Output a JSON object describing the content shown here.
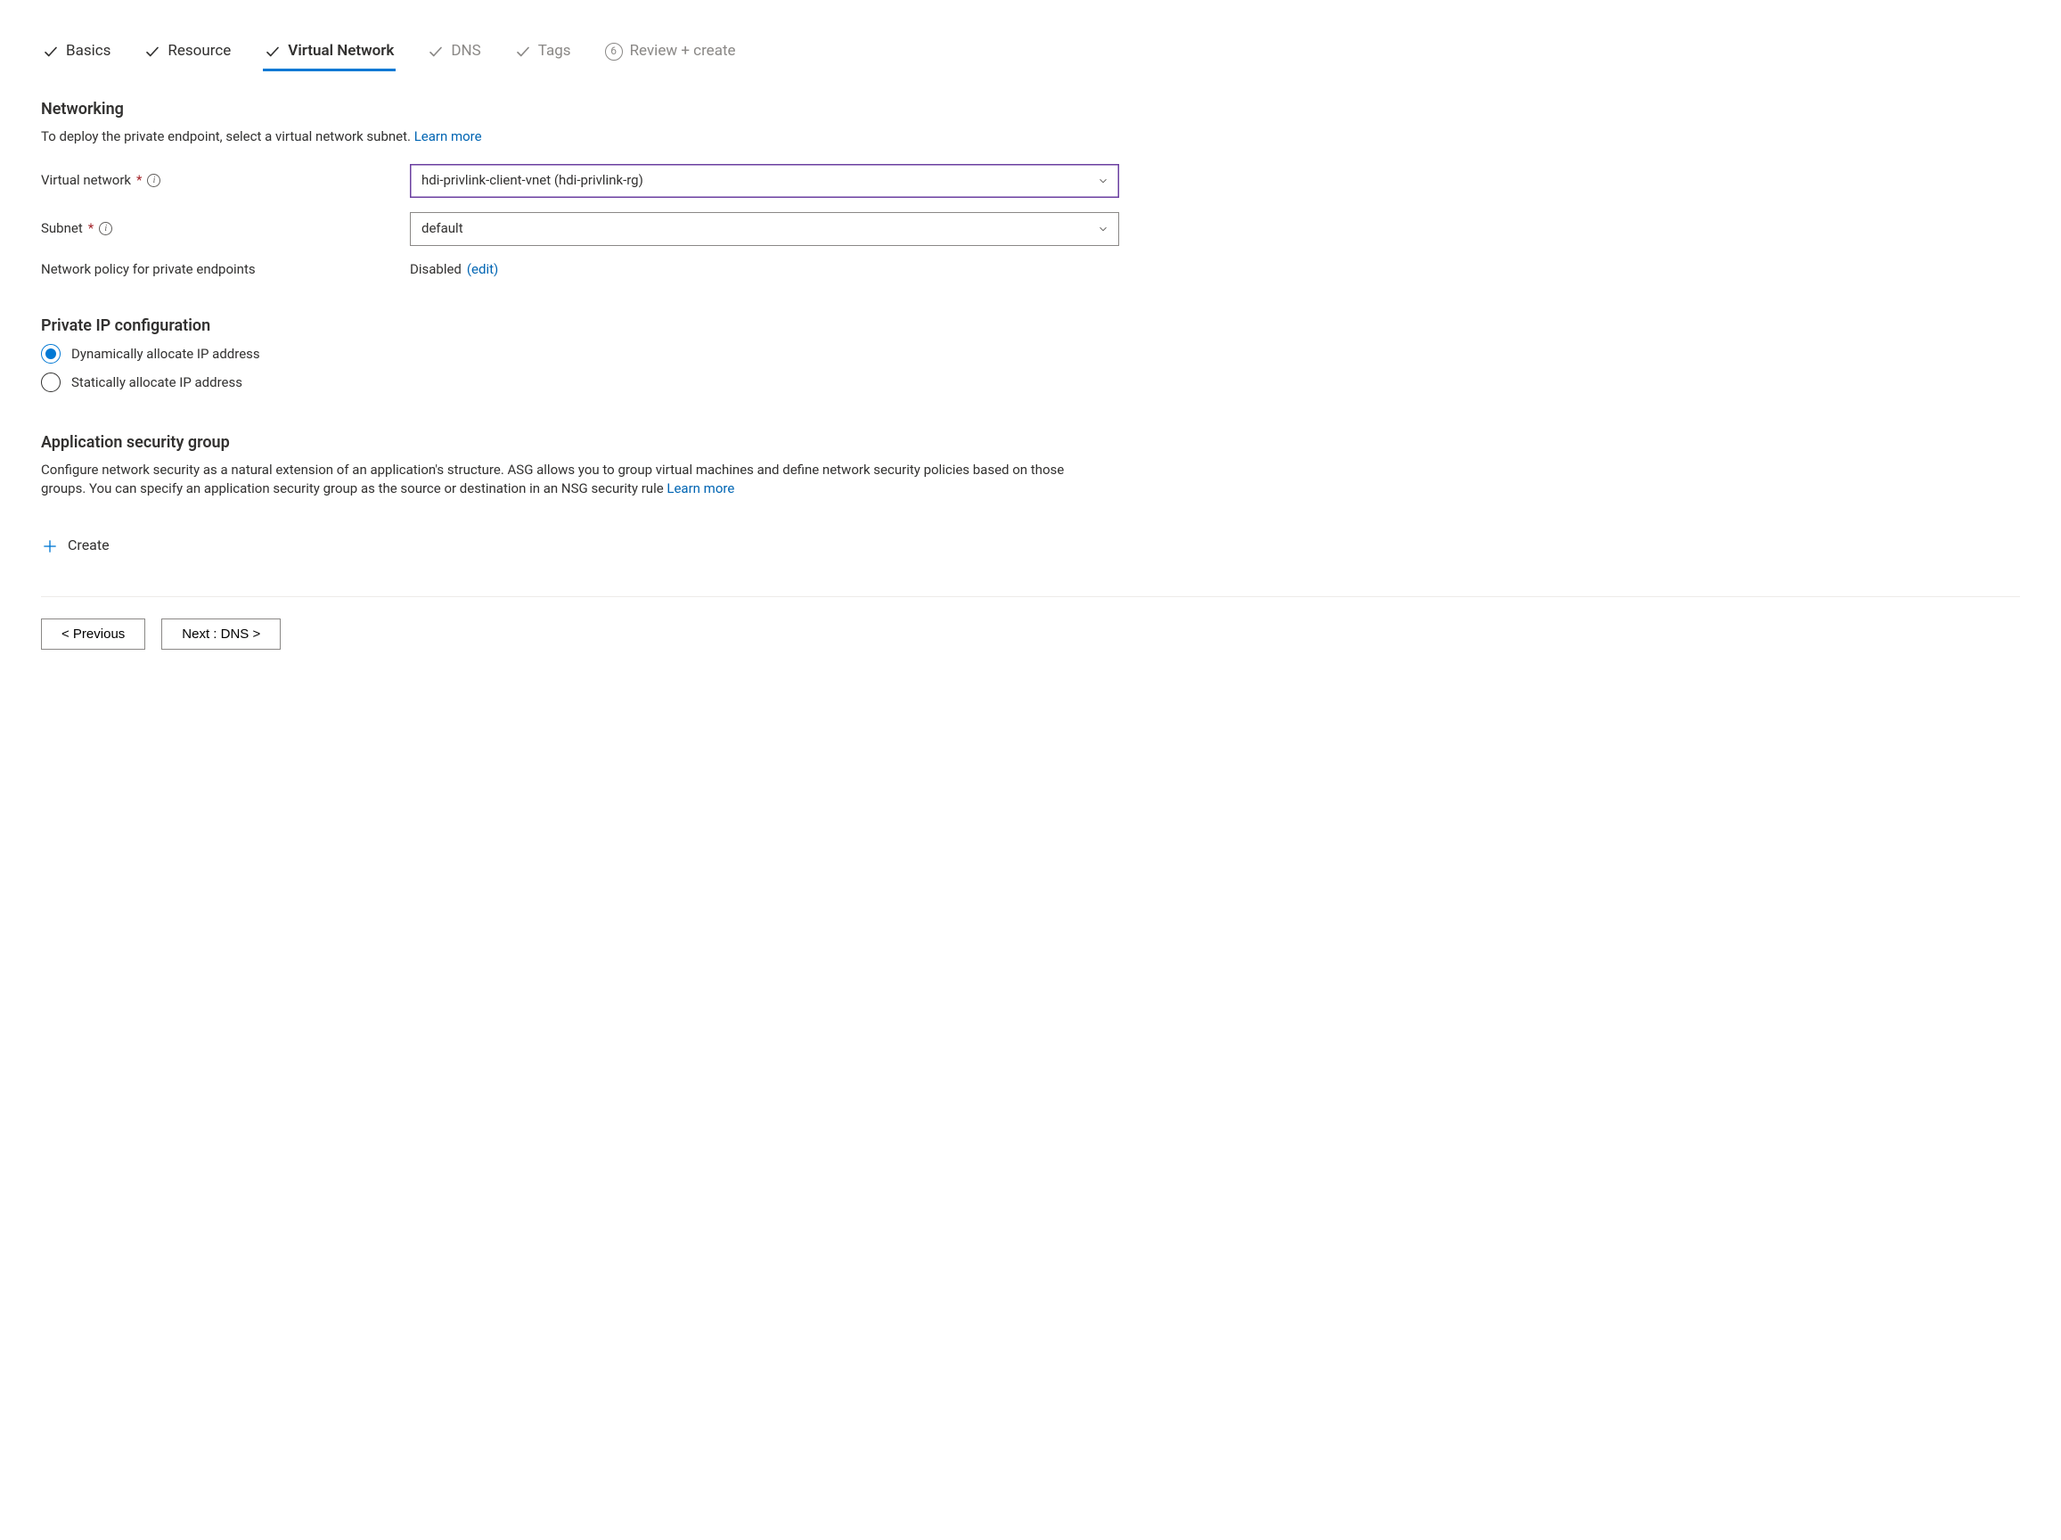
{
  "tabs": {
    "basics": "Basics",
    "resource": "Resource",
    "vnet": "Virtual Network",
    "dns": "DNS",
    "tags": "Tags",
    "review_num": "6",
    "review": "Review + create"
  },
  "networking": {
    "heading": "Networking",
    "desc": "To deploy the private endpoint, select a virtual network subnet.  ",
    "learn_more": "Learn more",
    "vnet_label": "Virtual network",
    "vnet_value": "hdi-privlink-client-vnet (hdi-privlink-rg)",
    "subnet_label": "Subnet",
    "subnet_value": "default",
    "policy_label": "Network policy for private endpoints",
    "policy_value": "Disabled",
    "policy_edit": "(edit)"
  },
  "ipconfig": {
    "heading": "Private IP configuration",
    "dynamic": "Dynamically allocate IP address",
    "static": "Statically allocate IP address"
  },
  "asg": {
    "heading": "Application security group",
    "desc": "Configure network security as a natural extension of an application's structure. ASG allows you to group virtual machines and define network security policies based on those groups. You can specify an application security group as the source or destination in an NSG security rule  ",
    "learn_more": "Learn more",
    "create": "Create"
  },
  "footer": {
    "prev": "< Previous",
    "next": "Next : DNS >"
  }
}
